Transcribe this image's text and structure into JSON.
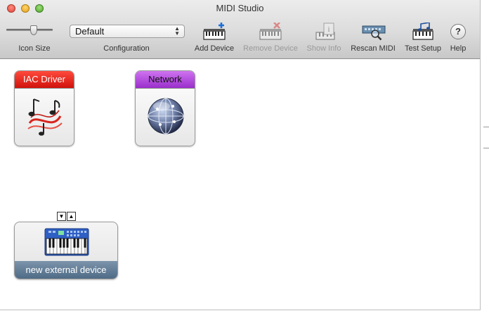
{
  "window": {
    "title": "MIDI Studio"
  },
  "toolbar": {
    "icon_size_label": "Icon Size",
    "configuration": {
      "label": "Configuration",
      "value": "Default"
    },
    "add_device": "Add Device",
    "remove_device": "Remove Device",
    "show_info": "Show Info",
    "rescan_midi": "Rescan MIDI",
    "test_setup": "Test Setup",
    "help": "Help",
    "help_glyph": "?"
  },
  "devices": [
    {
      "name": "IAC Driver",
      "icon": "midi-notes-icon",
      "color": "#e0190f"
    },
    {
      "name": "Network",
      "icon": "network-globe-icon",
      "color": "#b24fe0"
    }
  ],
  "external_device": {
    "name": "new external device",
    "icon": "keyboard-icon",
    "ports": [
      "▼",
      "▲"
    ]
  }
}
